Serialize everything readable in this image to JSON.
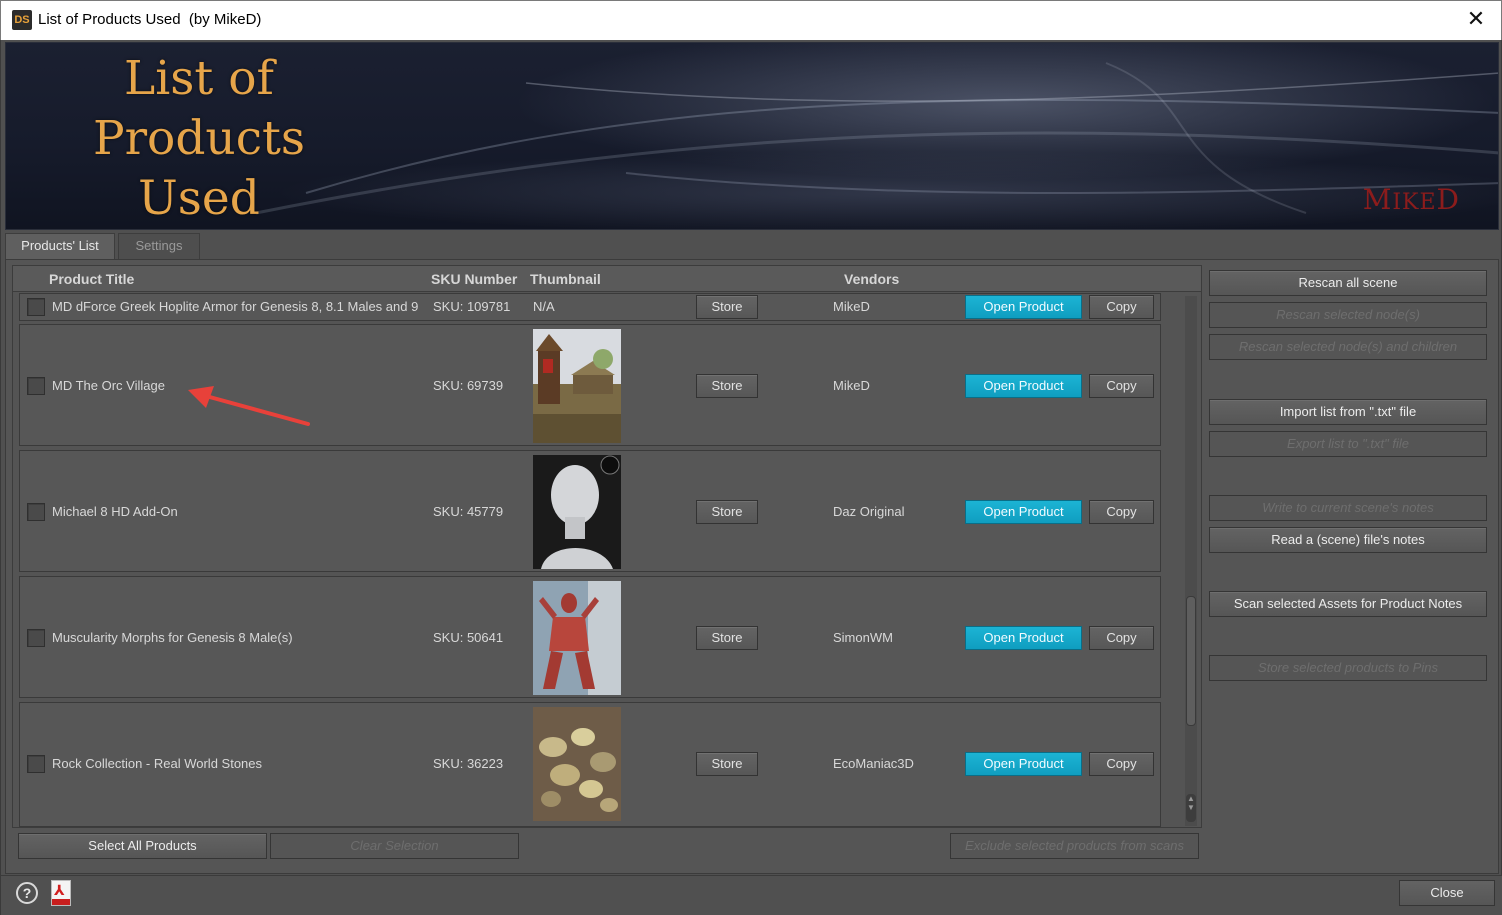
{
  "window": {
    "app_icon_text": "DS",
    "title": "List of Products Used  (by MikeD)",
    "close_glyph": "✕"
  },
  "banner": {
    "title_lines": [
      "List of",
      "Products",
      "Used"
    ],
    "brand_first": "M",
    "brand_rest": "IKE",
    "brand_last": "D"
  },
  "tabs": [
    {
      "label": "Products' List",
      "active": true
    },
    {
      "label": "Settings",
      "active": false
    }
  ],
  "list": {
    "headers": {
      "product_title": "Product Title",
      "sku": "SKU Number",
      "thumbnail": "Thumbnail",
      "vendors": "Vendors"
    },
    "rows": [
      {
        "title": "MD dForce Greek Hoplite Armor for Genesis 8, 8.1 Males and 9",
        "sku": "SKU: 109781",
        "thumbnail": "N/A",
        "vendor": "MikeD",
        "store": "Store",
        "open": "Open Product",
        "copy": "Copy"
      },
      {
        "title": "MD The Orc Village",
        "sku": "SKU: 69739",
        "thumbnail": "orc-village",
        "vendor": "MikeD",
        "store": "Store",
        "open": "Open Product",
        "copy": "Copy"
      },
      {
        "title": "Michael 8 HD Add-On",
        "sku": "SKU: 45779",
        "thumbnail": "head-bust",
        "vendor": "Daz Original",
        "store": "Store",
        "open": "Open Product",
        "copy": "Copy"
      },
      {
        "title": "Muscularity Morphs for Genesis 8 Male(s)",
        "sku": "SKU: 50641",
        "thumbnail": "muscle-figure",
        "vendor": "SimonWM",
        "store": "Store",
        "open": "Open Product",
        "copy": "Copy"
      },
      {
        "title": "Rock Collection - Real World Stones",
        "sku": "SKU: 36223",
        "thumbnail": "rocks",
        "vendor": "EcoManiac3D",
        "store": "Store",
        "open": "Open Product",
        "copy": "Copy"
      }
    ]
  },
  "actions": {
    "rescan_all": "Rescan all scene",
    "rescan_selected": "Rescan selected node(s)",
    "rescan_children": "Rescan selected node(s) and children",
    "import_list": "Import list from \".txt\" file",
    "export_list": "Export list to \".txt\" file",
    "write_notes": "Write to current scene's notes",
    "read_notes": "Read a (scene) file's notes",
    "scan_assets": "Scan selected Assets for Product Notes",
    "store_pins": "Store selected products to Pins"
  },
  "bottom": {
    "select_all": "Select All Products",
    "clear_selection": "Clear Selection",
    "exclude": "Exclude selected products from scans"
  },
  "statusbar": {
    "help_glyph": "?",
    "pdf_glyph": "⅄",
    "close": "Close"
  },
  "colors": {
    "accent_open_product": "#14a9cb",
    "banner_title": "#e6a54a",
    "brand": "#8c1c1c",
    "annotation_arrow": "#e8413a"
  }
}
